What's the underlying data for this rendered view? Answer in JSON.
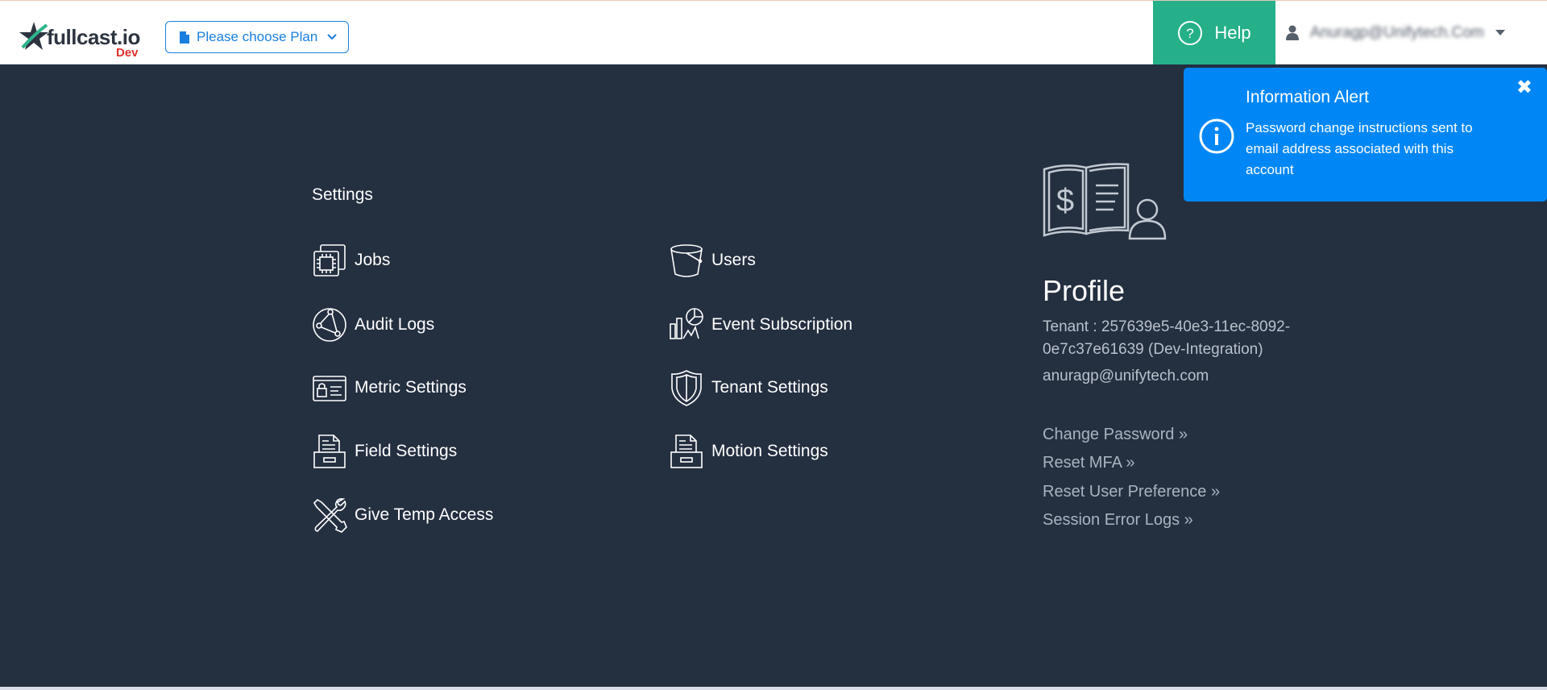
{
  "header": {
    "logo_text": "fullcast.io",
    "logo_env": "Dev",
    "plan_label": "Please choose Plan",
    "help_label": "Help",
    "user_name": "Anuragp@Unifytech.Com"
  },
  "settings": {
    "title": "Settings",
    "items": [
      {
        "label": "Jobs",
        "icon": "chip-icon"
      },
      {
        "label": "Users",
        "icon": "bucket-icon"
      },
      {
        "label": "Audit Logs",
        "icon": "network-globe-icon"
      },
      {
        "label": "Event Subscription",
        "icon": "analytics-icon"
      },
      {
        "label": "Metric Settings",
        "icon": "lock-card-icon"
      },
      {
        "label": "Tenant Settings",
        "icon": "shield-icon"
      },
      {
        "label": "Field Settings",
        "icon": "file-drawer-icon"
      },
      {
        "label": "Motion Settings",
        "icon": "file-drawer-icon"
      },
      {
        "label": "Give Temp Access",
        "icon": "tools-icon"
      }
    ]
  },
  "profile": {
    "title": "Profile",
    "tenant": "Tenant : 257639e5-40e3-11ec-8092-0e7c37e61639 (Dev-Integration)",
    "email": "anuragp@unifytech.com",
    "links": [
      "Change Password »",
      "Reset MFA »",
      "Reset User Preference »",
      "Session Error Logs »"
    ]
  },
  "alert": {
    "title": "Information Alert",
    "message": "Password change instructions sent to email address associated with this account"
  },
  "colors": {
    "background": "#242f40",
    "help": "#25b08a",
    "alert": "#0087f5",
    "link": "#1a7fe0"
  }
}
